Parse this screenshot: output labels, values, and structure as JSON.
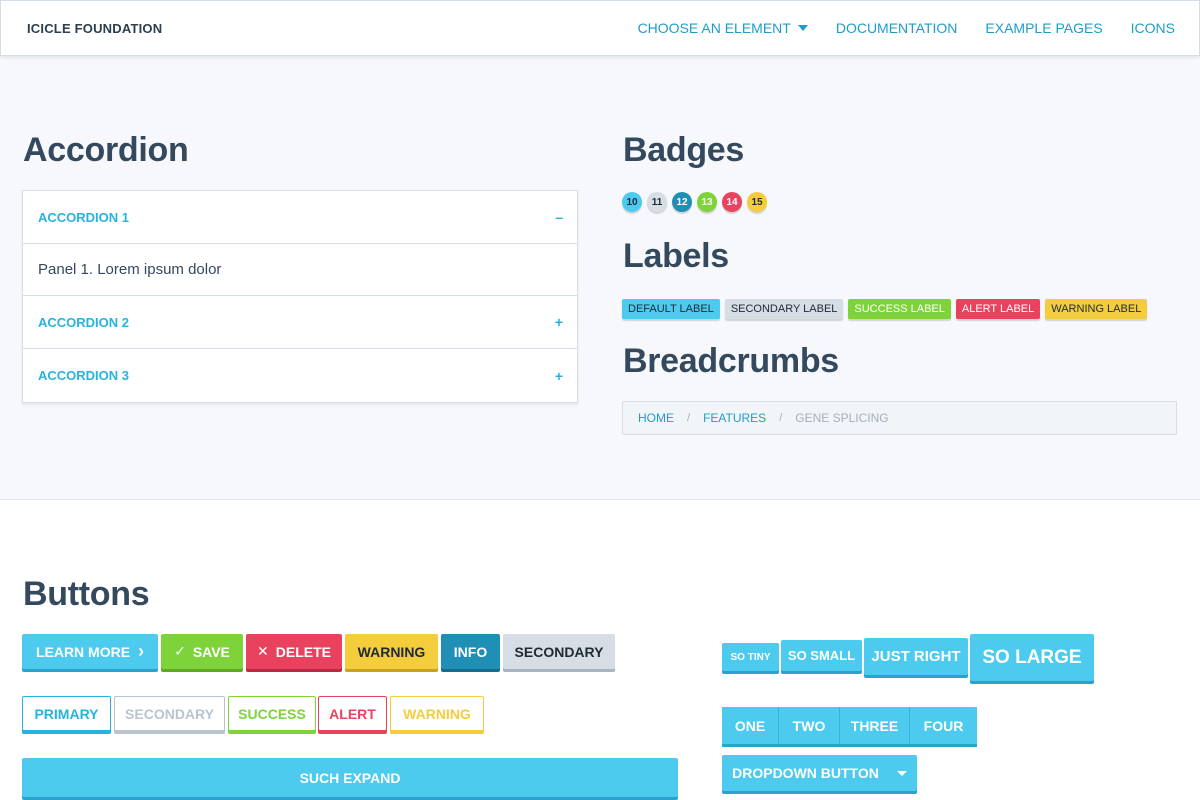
{
  "topbar": {
    "brand": "ICICLE FOUNDATION",
    "nav": [
      "CHOOSE AN ELEMENT",
      "DOCUMENTATION",
      "EXAMPLE PAGES",
      "ICONS"
    ]
  },
  "accordion": {
    "heading": "Accordion",
    "items": [
      {
        "title": "ACCORDION 1",
        "sign": "–",
        "panel": "Panel 1. Lorem ipsum dolor"
      },
      {
        "title": "ACCORDION 2",
        "sign": "+"
      },
      {
        "title": "ACCORDION 3",
        "sign": "+"
      }
    ]
  },
  "badges": {
    "heading": "Badges",
    "items": [
      {
        "text": "10",
        "bg": "#4ccbef",
        "fg": "#1e2b37"
      },
      {
        "text": "11",
        "bg": "#d6dde5",
        "fg": "#1e2b37"
      },
      {
        "text": "12",
        "bg": "#1f8fb5",
        "fg": "#ffffff"
      },
      {
        "text": "13",
        "bg": "#7ed33b",
        "fg": "#ffffff"
      },
      {
        "text": "14",
        "bg": "#e8425f",
        "fg": "#ffffff"
      },
      {
        "text": "15",
        "bg": "#f5cc3c",
        "fg": "#1e2b37"
      }
    ]
  },
  "labels": {
    "heading": "Labels",
    "items": [
      {
        "text": "DEFAULT LABEL",
        "bg": "#4ccbef",
        "fg": "#1e2b37"
      },
      {
        "text": "SECONDARY LABEL",
        "bg": "#d6dde5",
        "fg": "#1e2b37"
      },
      {
        "text": "SUCCESS LABEL",
        "bg": "#7ed33b",
        "fg": "#ffffff"
      },
      {
        "text": "ALERT LABEL",
        "bg": "#e8425f",
        "fg": "#ffffff"
      },
      {
        "text": "WARNING LABEL",
        "bg": "#f5cc3c",
        "fg": "#1e2b37"
      }
    ]
  },
  "breadcrumbs": {
    "heading": "Breadcrumbs",
    "items": [
      "HOME",
      "FEATURES",
      "GENE SPLICING"
    ],
    "separator": "/"
  },
  "buttons": {
    "heading": "Buttons",
    "row1": [
      {
        "text": "LEARN MORE",
        "bg": "#4ccbef",
        "shade": "#2aa3cc",
        "icon_right": "›"
      },
      {
        "text": "SAVE",
        "bg": "#7ed33b",
        "shade": "#5ea924",
        "icon_left": "✓"
      },
      {
        "text": "DELETE",
        "bg": "#e8425f",
        "shade": "#b92a44",
        "icon_left": "✕"
      },
      {
        "text": "WARNING",
        "bg": "#f5cc3c",
        "shade": "#c7a11f",
        "fg": "#1e2b37"
      },
      {
        "text": "INFO",
        "bg": "#1f8fb5",
        "shade": "#156d8b"
      },
      {
        "text": "SECONDARY",
        "bg": "#d6dde5",
        "shade": "#a8b4c0",
        "fg": "#1e2b37"
      }
    ],
    "row2": [
      {
        "text": "PRIMARY",
        "color": "#25b4e0"
      },
      {
        "text": "SECONDARY",
        "color": "#b9c4cf"
      },
      {
        "text": "SUCCESS",
        "color": "#7ed33b"
      },
      {
        "text": "ALERT",
        "color": "#e8425f"
      },
      {
        "text": "WARNING",
        "color": "#f5cc3c"
      }
    ],
    "expand": "SUCH EXPAND",
    "sizes": [
      "SO TINY",
      "SO SMALL",
      "JUST RIGHT",
      "SO LARGE"
    ],
    "group": [
      "ONE",
      "TWO",
      "THREE",
      "FOUR"
    ],
    "dropdown": "DROPDOWN BUTTON"
  },
  "colors": {
    "primary": "#4ccbef",
    "primary_shade": "#2aa3cc",
    "link": "#1f9cc7"
  }
}
